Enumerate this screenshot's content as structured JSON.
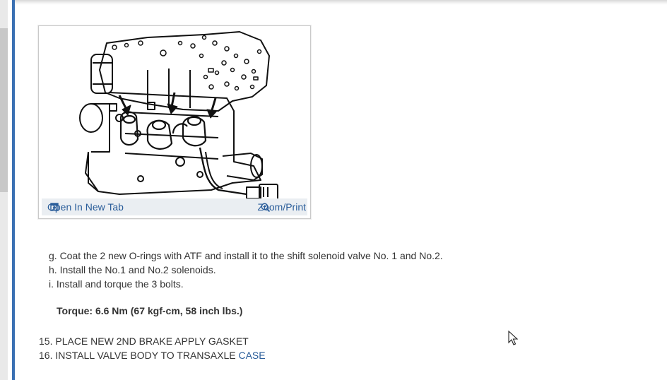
{
  "figure": {
    "open_tab_label": "Open In New Tab",
    "zoom_label": "Zoom/Print",
    "open_icon": "open-in-new-tab-icon",
    "zoom_icon": "magnifier-icon"
  },
  "steps": [
    "g. Coat the 2 new O-rings with ATF and install it to the shift solenoid valve No. 1 and No.2.",
    "h. Install the No.1 and No.2 solenoids.",
    "i. Install and torque the 3 bolts."
  ],
  "torque": "Torque: 6.6 Nm (67 kgf-cm, 58 inch lbs.)",
  "numbered_steps": {
    "step15": "15. PLACE NEW 2ND BRAKE APPLY GASKET",
    "step16_prefix": "16. INSTALL VALVE BODY TO TRANSAXLE ",
    "step16_link": "CASE"
  },
  "colors": {
    "link": "#2a5d9a",
    "accent_border": "#3a70b3",
    "text": "#333333"
  }
}
